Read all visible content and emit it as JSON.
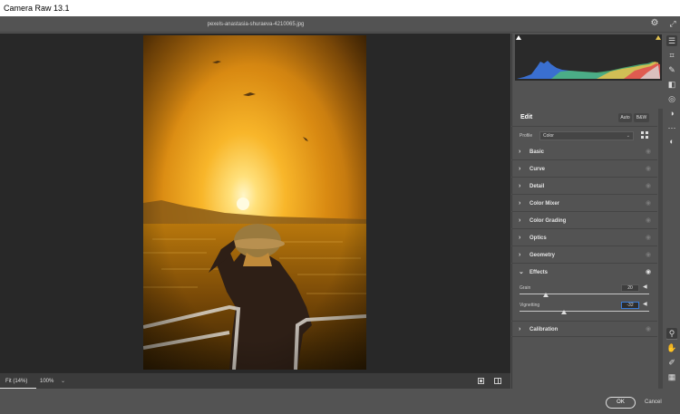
{
  "window": {
    "title": "Camera Raw 13.1"
  },
  "topbar": {
    "filename": "pexels-anastasia-shuraeva-4210065.jpg"
  },
  "bottombar": {
    "zoom_fit": "Fit (14%)",
    "zoom_level": "100%",
    "zoom_caret": "⌄"
  },
  "footer": {
    "ok_label": "OK",
    "cancel_label": "Cancel"
  },
  "panel": {
    "edit_title": "Edit",
    "auto_label": "Auto",
    "bw_label": "B&W",
    "profile_label": "Profile",
    "profile_value": "Color",
    "sections": [
      {
        "label": "Basic",
        "expanded": false
      },
      {
        "label": "Curve",
        "expanded": false
      },
      {
        "label": "Detail",
        "expanded": false
      },
      {
        "label": "Color Mixer",
        "expanded": false
      },
      {
        "label": "Color Grading",
        "expanded": false
      },
      {
        "label": "Optics",
        "expanded": false
      },
      {
        "label": "Geometry",
        "expanded": false
      },
      {
        "label": "Effects",
        "expanded": true
      },
      {
        "label": "Calibration",
        "expanded": false
      }
    ],
    "effects": {
      "grain_label": "Grain",
      "grain_value": "20",
      "vignetting_label": "Vignetting",
      "vignetting_value": "-32"
    }
  },
  "icons": {
    "section_collapsed": "›",
    "section_expanded": "⌄",
    "eye": "◉",
    "arrow_left": "◀",
    "dropdown": "⌄"
  },
  "tools": [
    "edit-sliders-icon",
    "crop-icon",
    "healing-brush-icon",
    "masking-icon",
    "red-eye-icon",
    "presets-icon",
    "more-icon",
    "zoom-icon",
    "hand-icon",
    "color-sampler-icon",
    "grid-icon"
  ],
  "colors": {
    "accent": "#3b7cd6",
    "panel_bg": "#535353",
    "canvas_bg": "#282828"
  }
}
